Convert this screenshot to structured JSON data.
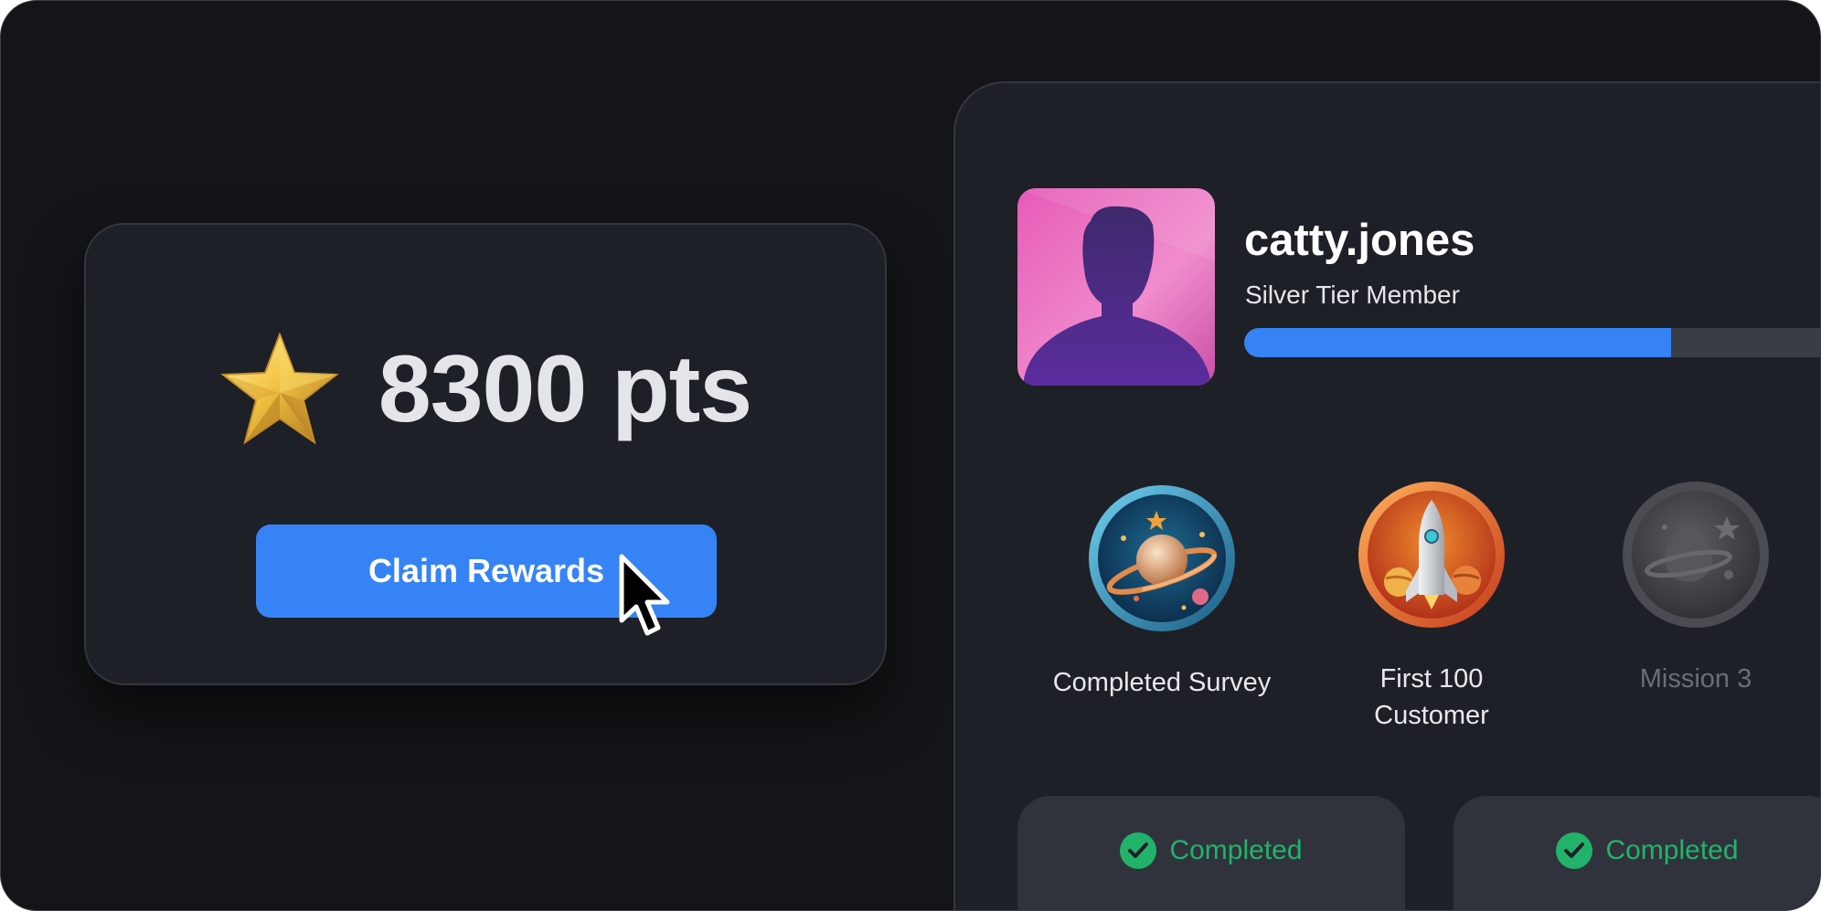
{
  "points": {
    "icon": "gold-star-icon",
    "value": "8300 pts",
    "claim_label": "Claim Rewards"
  },
  "profile": {
    "avatar_icon": "person-silhouette-icon",
    "username": "catty.jones",
    "tier": "Silver Tier Member",
    "tier_progress_fraction": 0.73
  },
  "badges": [
    {
      "label": "Completed Survey",
      "icon": "planet-badge-icon",
      "locked": false
    },
    {
      "label": "First 100 Customer",
      "icon": "rocket-badge-icon",
      "locked": false
    },
    {
      "label": "Mission 3",
      "icon": "locked-planet-badge-icon",
      "locked": true
    }
  ],
  "statuses": [
    {
      "label": "Completed",
      "icon": "check-circle-icon"
    },
    {
      "label": "Completed",
      "icon": "check-circle-icon"
    }
  ],
  "colors": {
    "accent": "#3683f5",
    "success": "#22b36b",
    "background": "#141518",
    "card": "#1e2027"
  }
}
